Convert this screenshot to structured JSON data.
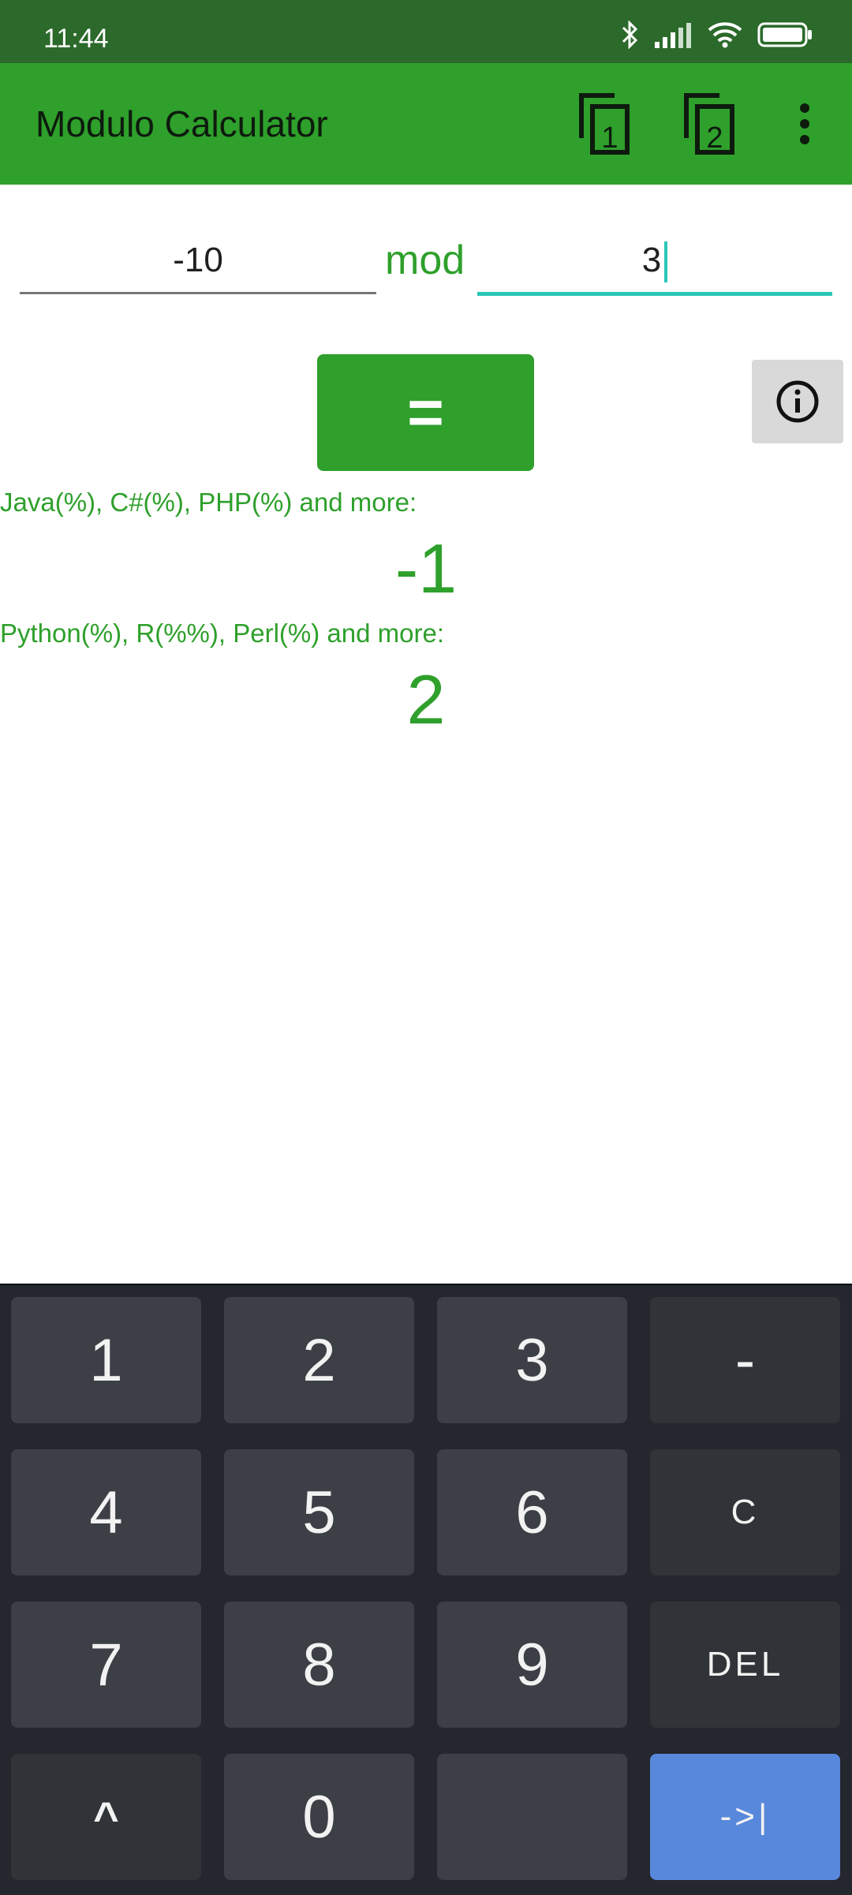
{
  "status_bar": {
    "time": "11:44",
    "icons": [
      "bluetooth-icon",
      "signal-icon",
      "wifi-icon",
      "battery-icon"
    ]
  },
  "app_bar": {
    "title": "Modulo Calculator",
    "action1_label": "1",
    "action2_label": "2",
    "background": "#2ea02b"
  },
  "inputs": {
    "dividend": "-10",
    "operator": "mod",
    "divisor": "3"
  },
  "buttons": {
    "equals": "="
  },
  "results": {
    "first_label": "Java(%), C#(%), PHP(%) and more:",
    "first_value": "-1",
    "second_label": "Python(%), R(%%), Perl(%) and more:",
    "second_value": "2"
  },
  "keypad": {
    "keys": [
      "1",
      "2",
      "3",
      "-",
      "4",
      "5",
      "6",
      "C",
      "7",
      "8",
      "9",
      "DEL",
      "^",
      "0",
      "",
      "->|"
    ]
  }
}
